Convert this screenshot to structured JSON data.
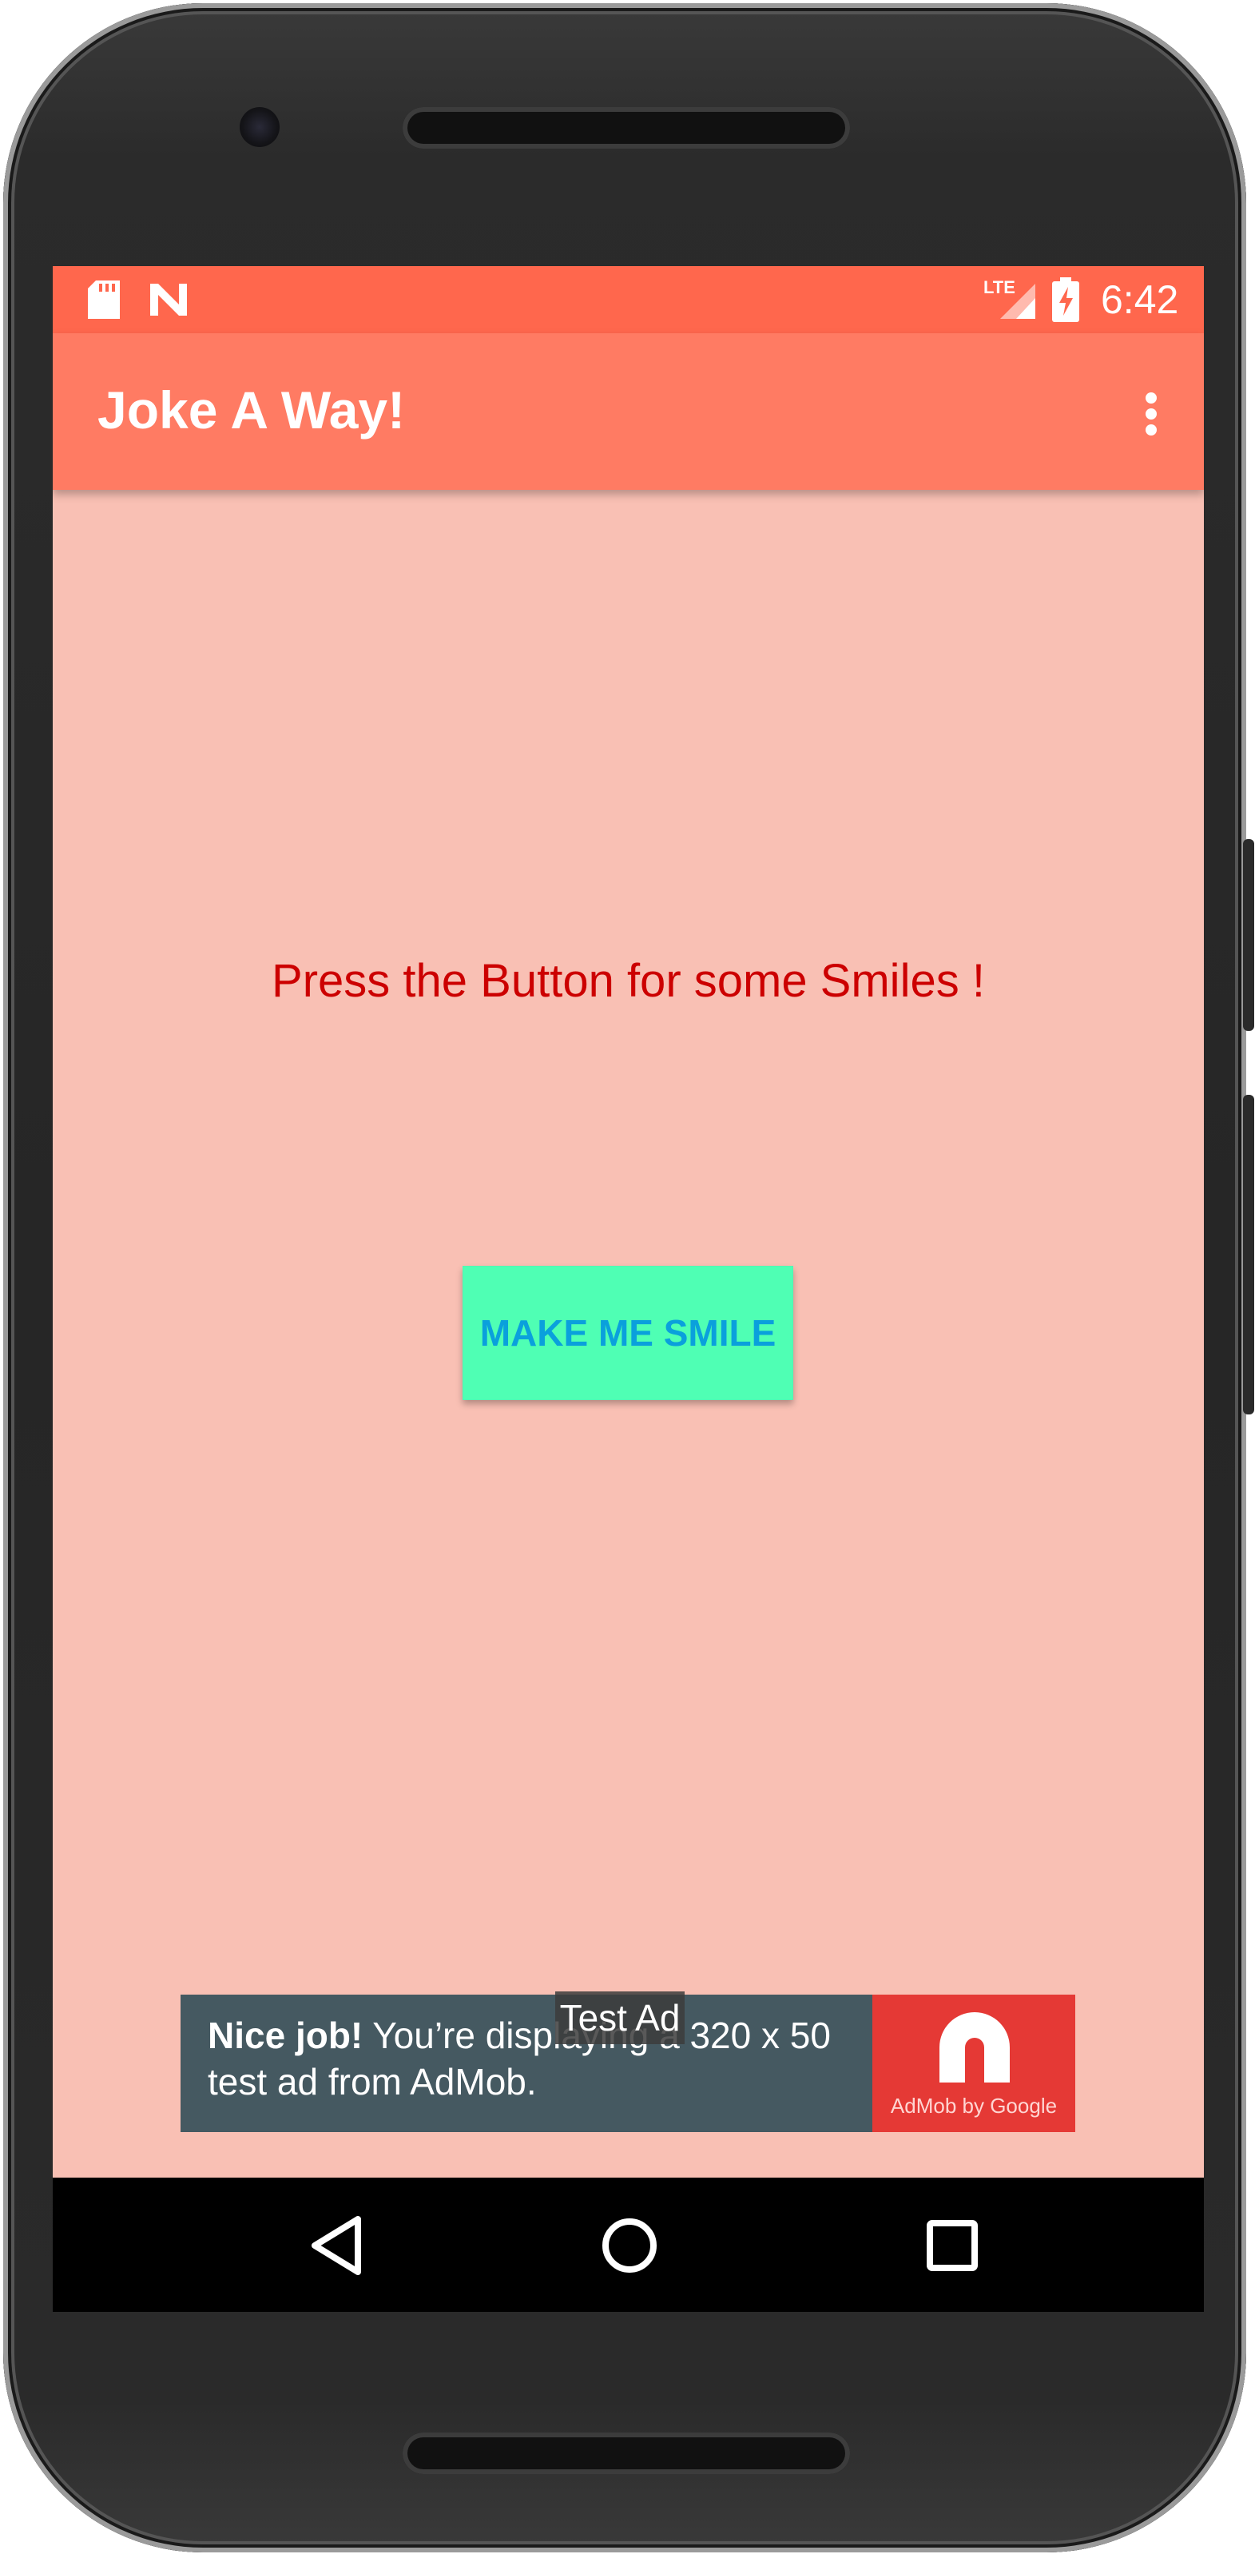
{
  "status_bar": {
    "network_type": "LTE",
    "time": "6:42",
    "icons": [
      "sd-card-icon",
      "android-n-icon",
      "signal-icon",
      "battery-charging-icon"
    ]
  },
  "app_bar": {
    "title": "Joke A Way!",
    "menu_icon": "more-vert-icon"
  },
  "main": {
    "prompt": "Press the Button for some Smiles !",
    "button_label": "MAKE ME SMILE"
  },
  "ad_banner": {
    "badge": "Test Ad",
    "headline": "Nice job!",
    "message": " You’re displaying a 320 x 50 test ad from AdMob.",
    "logo_caption": "AdMob by Google"
  },
  "nav_bar": {
    "back_icon": "back-triangle-icon",
    "home_icon": "home-circle-icon",
    "recents_icon": "recents-square-icon"
  },
  "colors": {
    "status_bar": "#FF674D",
    "app_bar": "#FF7B63",
    "background": "#F9C0B4",
    "prompt_text": "#CC0000",
    "button_bg": "#4FFFB4",
    "button_text": "#0AA0DC",
    "ad_bg": "#455961",
    "ad_logo_bg": "#E53935"
  }
}
